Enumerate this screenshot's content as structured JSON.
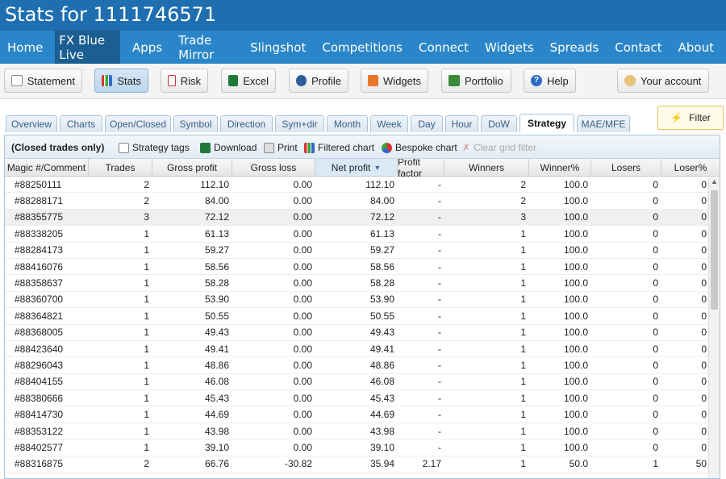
{
  "title": "Stats for 1111746571",
  "nav": [
    "Home",
    "FX Blue Live",
    "Apps",
    "Trade Mirror",
    "Slingshot",
    "Competitions",
    "Connect",
    "Widgets",
    "Spreads",
    "Contact",
    "About"
  ],
  "toolbar": {
    "statement": "Statement",
    "stats": "Stats",
    "risk": "Risk",
    "excel": "Excel",
    "profile": "Profile",
    "widgets": "Widgets",
    "portfolio": "Portfolio",
    "help": "Help",
    "account": "Your account"
  },
  "tabs": [
    "Overview",
    "Charts",
    "Open/Closed",
    "Symbol",
    "Direction",
    "Sym+dir",
    "Month",
    "Week",
    "Day",
    "Hour",
    "DoW",
    "Strategy",
    "MAE/MFE"
  ],
  "filter_label": "Filter",
  "panel": {
    "closed_label": "(Closed trades only)",
    "strategy_tags": "Strategy tags",
    "download": "Download",
    "print": "Print",
    "filtered_chart": "Filtered chart",
    "bespoke_chart": "Bespoke chart",
    "clear_filter": "Clear grid filter"
  },
  "columns": [
    "Magic #/Comment",
    "Trades",
    "Gross profit",
    "Gross loss",
    "Net profit",
    "Profit factor",
    "Winners",
    "Winner%",
    "Losers",
    "Loser%"
  ],
  "rows": [
    [
      "#88250111",
      "2",
      "112.10",
      "0.00",
      "112.10",
      "-",
      "2",
      "100.0",
      "0",
      "0"
    ],
    [
      "#88288171",
      "2",
      "84.00",
      "0.00",
      "84.00",
      "-",
      "2",
      "100.0",
      "0",
      "0"
    ],
    [
      "#88355775",
      "3",
      "72.12",
      "0.00",
      "72.12",
      "-",
      "3",
      "100.0",
      "0",
      "0"
    ],
    [
      "#88338205",
      "1",
      "61.13",
      "0.00",
      "61.13",
      "-",
      "1",
      "100.0",
      "0",
      "0"
    ],
    [
      "#88284173",
      "1",
      "59.27",
      "0.00",
      "59.27",
      "-",
      "1",
      "100.0",
      "0",
      "0"
    ],
    [
      "#88416076",
      "1",
      "58.56",
      "0.00",
      "58.56",
      "-",
      "1",
      "100.0",
      "0",
      "0"
    ],
    [
      "#88358637",
      "1",
      "58.28",
      "0.00",
      "58.28",
      "-",
      "1",
      "100.0",
      "0",
      "0"
    ],
    [
      "#88360700",
      "1",
      "53.90",
      "0.00",
      "53.90",
      "-",
      "1",
      "100.0",
      "0",
      "0"
    ],
    [
      "#88364821",
      "1",
      "50.55",
      "0.00",
      "50.55",
      "-",
      "1",
      "100.0",
      "0",
      "0"
    ],
    [
      "#88368005",
      "1",
      "49.43",
      "0.00",
      "49.43",
      "-",
      "1",
      "100.0",
      "0",
      "0"
    ],
    [
      "#88423640",
      "1",
      "49.41",
      "0.00",
      "49.41",
      "-",
      "1",
      "100.0",
      "0",
      "0"
    ],
    [
      "#88296043",
      "1",
      "48.86",
      "0.00",
      "48.86",
      "-",
      "1",
      "100.0",
      "0",
      "0"
    ],
    [
      "#88404155",
      "1",
      "46.08",
      "0.00",
      "46.08",
      "-",
      "1",
      "100.0",
      "0",
      "0"
    ],
    [
      "#88380666",
      "1",
      "45.43",
      "0.00",
      "45.43",
      "-",
      "1",
      "100.0",
      "0",
      "0"
    ],
    [
      "#88414730",
      "1",
      "44.69",
      "0.00",
      "44.69",
      "-",
      "1",
      "100.0",
      "0",
      "0"
    ],
    [
      "#88353122",
      "1",
      "43.98",
      "0.00",
      "43.98",
      "-",
      "1",
      "100.0",
      "0",
      "0"
    ],
    [
      "#88402577",
      "1",
      "39.10",
      "0.00",
      "39.10",
      "-",
      "1",
      "100.0",
      "0",
      "0"
    ],
    [
      "#88316875",
      "2",
      "66.76",
      "-30.82",
      "35.94",
      "2.17",
      "1",
      "50.0",
      "1",
      "50"
    ]
  ]
}
